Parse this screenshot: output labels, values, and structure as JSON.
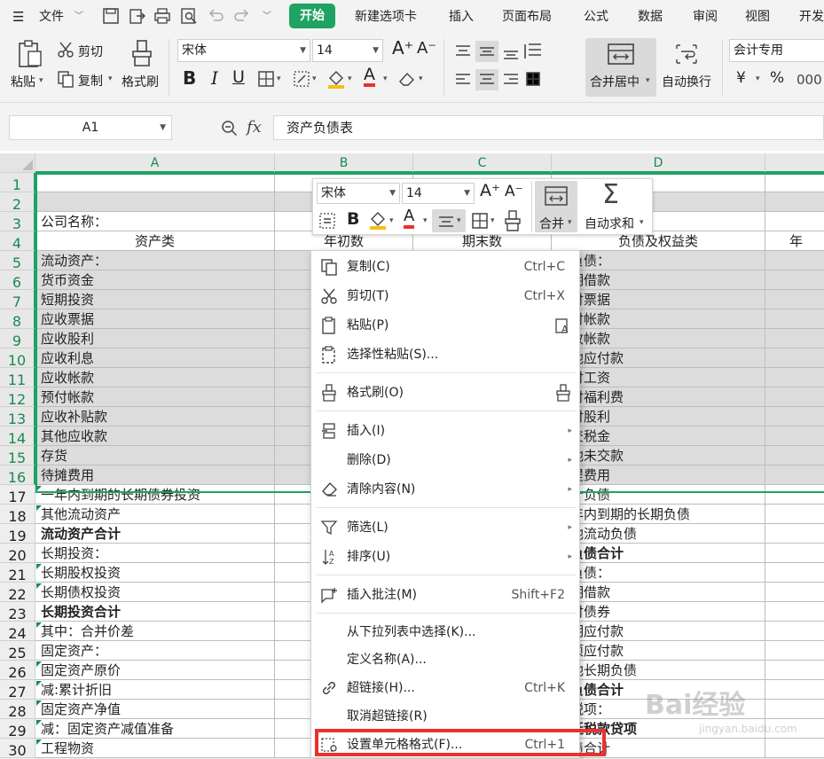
{
  "menubar": {
    "file": "文件",
    "tabs": [
      "开始",
      "新建选项卡",
      "插入",
      "页面布局",
      "公式",
      "数据",
      "审阅",
      "视图",
      "开发"
    ]
  },
  "ribbon": {
    "paste": "粘贴",
    "cut": "剪切",
    "copy": "复制",
    "format_painter": "格式刷",
    "font_name": "宋体",
    "font_size": "14",
    "merge_center": "合并居中",
    "wrap": "自动换行",
    "number_format": "会计专用",
    "currency": "¥",
    "percent": "%"
  },
  "formula_bar": {
    "name_box": "A1",
    "fx": "fx",
    "content": "资产负债表"
  },
  "columns": [
    "A",
    "B",
    "C",
    "D"
  ],
  "rows": [
    {
      "n": "1",
      "a": "",
      "b": "",
      "c": "",
      "d": "",
      "e": ""
    },
    {
      "n": "2",
      "a": "",
      "b": "",
      "c": "",
      "d": "",
      "e": ""
    },
    {
      "n": "3",
      "a": "公司名称：",
      "b": "",
      "c": "",
      "d": "",
      "e": ""
    },
    {
      "n": "4",
      "a": "资产类",
      "b": "年初数",
      "c": "期末数",
      "d": "负债及权益类",
      "e": "年"
    },
    {
      "n": "5",
      "a": "流动资产：",
      "d": "动负债："
    },
    {
      "n": "6",
      "a": "  货币资金",
      "d": "短期借款"
    },
    {
      "n": "7",
      "a": "  短期投资",
      "d": "应付票据"
    },
    {
      "n": "8",
      "a": "  应收票据",
      "d": "应付帐款"
    },
    {
      "n": "9",
      "a": "  应收股利",
      "d": "预收帐款"
    },
    {
      "n": "10",
      "a": "  应收利息",
      "d": "其他应付款"
    },
    {
      "n": "11",
      "a": "  应收帐款",
      "d": "应付工资"
    },
    {
      "n": "12",
      "a": "  预付帐款",
      "d": "应付福利费"
    },
    {
      "n": "13",
      "a": "  应收补贴款",
      "d": "应付股利"
    },
    {
      "n": "14",
      "a": "  其他应收款",
      "d": "应交税金"
    },
    {
      "n": "15",
      "a": "  存货",
      "d": "其他未交款"
    },
    {
      "n": "16",
      "a": "  待摊费用",
      "d": "预提费用"
    },
    {
      "n": "17",
      "a": "  一年内到期的长期债券投资",
      "d": "预计负债"
    },
    {
      "n": "18",
      "a": "  其他流动资产",
      "d": "一年内到期的长期负债"
    },
    {
      "n": "19",
      "a": "流动资产合计",
      "d": "其他流动负债",
      "bold_a": true
    },
    {
      "n": "20",
      "a": "长期投资：",
      "d": "动负债合计",
      "bold_d": true
    },
    {
      "n": "21",
      "a": "  长期股权投资",
      "d": "期负债："
    },
    {
      "n": "22",
      "a": "  长期债权投资",
      "d": "长期借款"
    },
    {
      "n": "23",
      "a": "长期投资合计",
      "d": "应付债券",
      "bold_a": true
    },
    {
      "n": "24",
      "a": "  其中：合并价差",
      "d": "长期应付款"
    },
    {
      "n": "25",
      "a": "固定资产：",
      "d": "专项应付款"
    },
    {
      "n": "26",
      "a": "  固定资产原价",
      "d": "其他长期负债"
    },
    {
      "n": "27",
      "a": "    减:累计折旧",
      "d": "期负债合计",
      "bold_d": true
    },
    {
      "n": "28",
      "a": "  固定资产净值",
      "d": "延税项："
    },
    {
      "n": "29",
      "a": "    减：固定资产减值准备",
      "d": "递延税款贷项",
      "bold_d": true
    },
    {
      "n": "30",
      "a": "  工程物资",
      "d": "负债合计"
    }
  ],
  "minibar": {
    "font_name": "宋体",
    "font_size": "14",
    "merge": "合并",
    "autosum": "自动求和"
  },
  "context_menu": {
    "items": [
      {
        "label": "复制(C)",
        "shortcut": "Ctrl+C",
        "icon": "copy-icon"
      },
      {
        "label": "剪切(T)",
        "shortcut": "Ctrl+X",
        "icon": "scissors-icon"
      },
      {
        "label": "粘贴(P)",
        "shortcut": "",
        "icon": "paste-icon"
      },
      {
        "label": "选择性粘贴(S)...",
        "shortcut": "",
        "icon": "paste-special-icon"
      },
      {
        "label": "格式刷(O)",
        "shortcut": "",
        "icon": "format-painter-icon"
      },
      {
        "label": "插入(I)",
        "shortcut": "",
        "icon": "insert-icon"
      },
      {
        "label": "删除(D)",
        "shortcut": "",
        "icon": ""
      },
      {
        "label": "清除内容(N)",
        "shortcut": "",
        "icon": "eraser-icon"
      },
      {
        "label": "筛选(L)",
        "shortcut": "",
        "icon": "filter-icon"
      },
      {
        "label": "排序(U)",
        "shortcut": "",
        "icon": "sort-icon"
      },
      {
        "label": "插入批注(M)",
        "shortcut": "Shift+F2",
        "icon": "comment-icon"
      },
      {
        "label": "从下拉列表中选择(K)...",
        "shortcut": "",
        "icon": ""
      },
      {
        "label": "定义名称(A)...",
        "shortcut": "",
        "icon": ""
      },
      {
        "label": "超链接(H)...",
        "shortcut": "Ctrl+K",
        "icon": "link-icon"
      },
      {
        "label": "取消超链接(R)",
        "shortcut": "",
        "icon": ""
      },
      {
        "label": "设置单元格格式(F)...",
        "shortcut": "Ctrl+1",
        "icon": "format-cells-icon"
      }
    ]
  },
  "watermark": {
    "text": "Bai经验",
    "sub": "jingyan.baidu.com"
  },
  "colors": {
    "accent": "#1ea362",
    "highlight": "#e8322f",
    "selection": "#dcdcdc"
  }
}
